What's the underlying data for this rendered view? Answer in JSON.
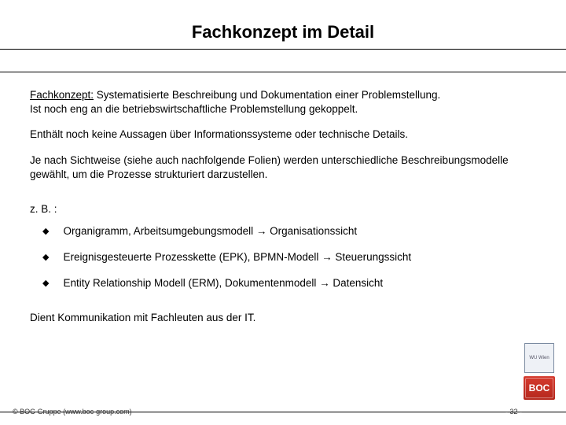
{
  "title": "Fachkonzept im Detail",
  "lead": {
    "label": "Fachkonzept:",
    "text_line1": " Systematisierte Beschreibung und Dokumentation einer Problemstellung.",
    "text_line2": "Ist noch eng an die betriebswirtschaftliche Problemstellung gekoppelt."
  },
  "para2": "Enthält noch keine Aussagen über Informationssysteme oder technische Details.",
  "para3": "Je nach Sichtweise (siehe auch nachfolgende Folien) werden unterschiedliche Beschreibungsmodelle gewählt, um die Prozesse strukturiert darzustellen.",
  "example_label": "z. B. :",
  "bullets": [
    "Organigramm, Arbeitsumgebungsmodell → Organisationssicht",
    "Ereignisgesteuerte Prozesskette (EPK), BPMN-Modell → Steuerungssicht",
    "Entity Relationship Modell (ERM), Dokumentenmodell → Datensicht"
  ],
  "closing": "Dient Kommunikation mit Fachleuten aus der IT.",
  "footer": {
    "copyright": "© BOC-Gruppe (www.boc-group.com)",
    "page": "- 32 -"
  },
  "logos": {
    "university_alt": "WU Wien",
    "boc_label": "BOC"
  }
}
